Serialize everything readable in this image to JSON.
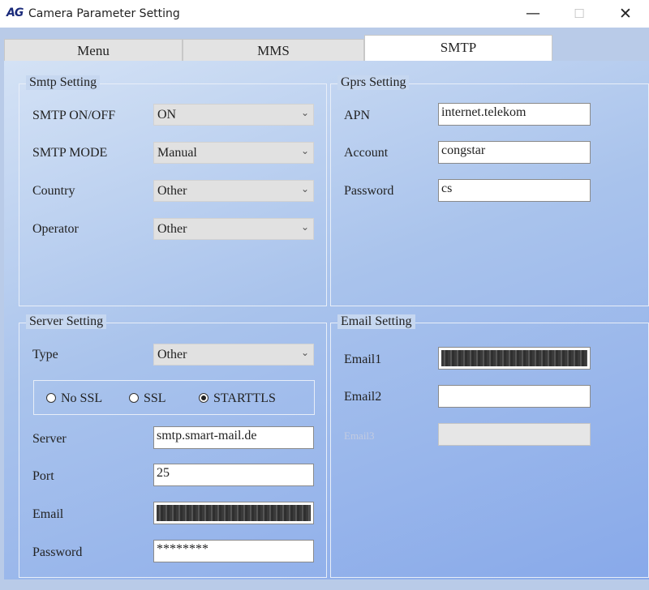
{
  "window": {
    "logo": "AG",
    "title": "Camera Parameter Setting",
    "minimize_glyph": "—",
    "maximize_glyph": "☐",
    "close_glyph": "✕"
  },
  "tabs": [
    {
      "label": "Menu",
      "active": false
    },
    {
      "label": "MMS",
      "active": false
    },
    {
      "label": "SMTP",
      "active": true
    }
  ],
  "smtp_setting": {
    "title": "Smtp Setting",
    "onoff": {
      "label": "SMTP ON/OFF",
      "value": "ON"
    },
    "mode": {
      "label": "SMTP MODE",
      "value": "Manual"
    },
    "country": {
      "label": "Country",
      "value": "Other"
    },
    "operator": {
      "label": "Operator",
      "value": "Other"
    }
  },
  "gprs_setting": {
    "title": "Gprs Setting",
    "apn": {
      "label": "APN",
      "value": "internet.telekom"
    },
    "account": {
      "label": "Account",
      "value": "congstar"
    },
    "password": {
      "label": "Password",
      "value": "cs"
    }
  },
  "server_setting": {
    "title": "Server Setting",
    "type": {
      "label": "Type",
      "value": "Other"
    },
    "ssl_options": [
      {
        "label": "No SSL",
        "selected": false
      },
      {
        "label": "SSL",
        "selected": false
      },
      {
        "label": "STARTTLS",
        "selected": true
      }
    ],
    "server": {
      "label": "Server",
      "value": "smtp.smart-mail.de"
    },
    "port": {
      "label": "Port",
      "value": "25"
    },
    "email": {
      "label": "Email",
      "value": ""
    },
    "password": {
      "label": "Password",
      "value": "********"
    }
  },
  "email_setting": {
    "title": "Email Setting",
    "email1": {
      "label": "Email1",
      "value": ""
    },
    "email2": {
      "label": "Email2",
      "value": ""
    },
    "email3": {
      "label": "Email3",
      "value": ""
    }
  },
  "icons": {
    "dropdown": "chevron-down-icon"
  },
  "colors": {
    "panel_top": "#d4e2f5",
    "panel_bottom": "#88a9ea",
    "active_tab": "#ffffff"
  }
}
